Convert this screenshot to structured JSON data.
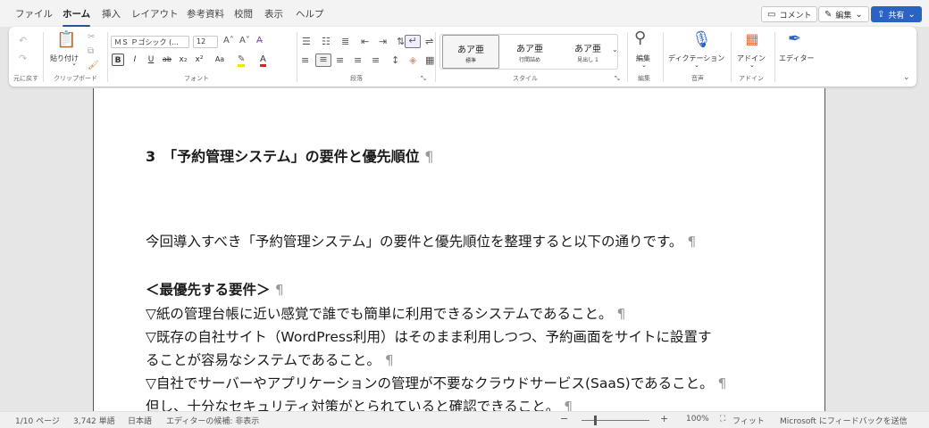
{
  "menu": {
    "tabs": [
      "ファイル",
      "ホーム",
      "挿入",
      "レイアウト",
      "参考資料",
      "校閲",
      "表示",
      "ヘルプ"
    ],
    "active_tab": "ホーム",
    "comment_label": "コメント",
    "edit_label": "編集",
    "share_label": "共有"
  },
  "ribbon": {
    "undo": {
      "label": "元に戻す"
    },
    "clipboard": {
      "paste_label": "貼り付け",
      "group_label": "クリップボード"
    },
    "font": {
      "name": "ＭＳ Ｐゴシック (...",
      "size": "12",
      "group_label": "フォント",
      "buttons": [
        "B",
        "I",
        "U",
        "ab",
        "x₂",
        "x²",
        "Aa"
      ]
    },
    "paragraph": {
      "group_label": "段落"
    },
    "styles": {
      "group_label": "スタイル",
      "items": [
        {
          "sample": "あア亜",
          "name": "標準"
        },
        {
          "sample": "あア亜",
          "name": "行間詰め"
        },
        {
          "sample": "あア亜",
          "name": "見出し 1"
        }
      ]
    },
    "editing": {
      "label": "編集",
      "group_label": "編集"
    },
    "voice": {
      "label": "ディクテーション",
      "group_label": "音声"
    },
    "addins": {
      "label": "アドイン",
      "group_label": "アドイン"
    },
    "editor": {
      "label": "エディター"
    }
  },
  "document": {
    "heading": "3　「予約管理システム」の要件と優先順位",
    "intro": "今回導入すべき「予約管理システム」の要件と優先順位を整理すると以下の通りです。",
    "subheading": "＜最優先する要件＞",
    "lines": [
      "▽紙の管理台帳に近い感覚で誰でも簡単に利用できるシステムであること。",
      "▽既存の自社サイト（WordPress利用）はそのまま利用しつつ、予約画面をサイトに設置す",
      "ることが容易なシステムであること。",
      "▽自社でサーバーやアプリケーションの管理が不要なクラウドサービス(SaaS)であること。",
      "但し、十分なセキュリティ対策がとられていると確認できること。"
    ],
    "pilcrow": "¶"
  },
  "status": {
    "page": "1/10 ページ",
    "words": "3,742 単語",
    "language": "日本語",
    "editor": "エディターの候補: 非表示",
    "zoom": "100%",
    "fit": "フィット",
    "feedback": "Microsoft にフィードバックを送信"
  }
}
